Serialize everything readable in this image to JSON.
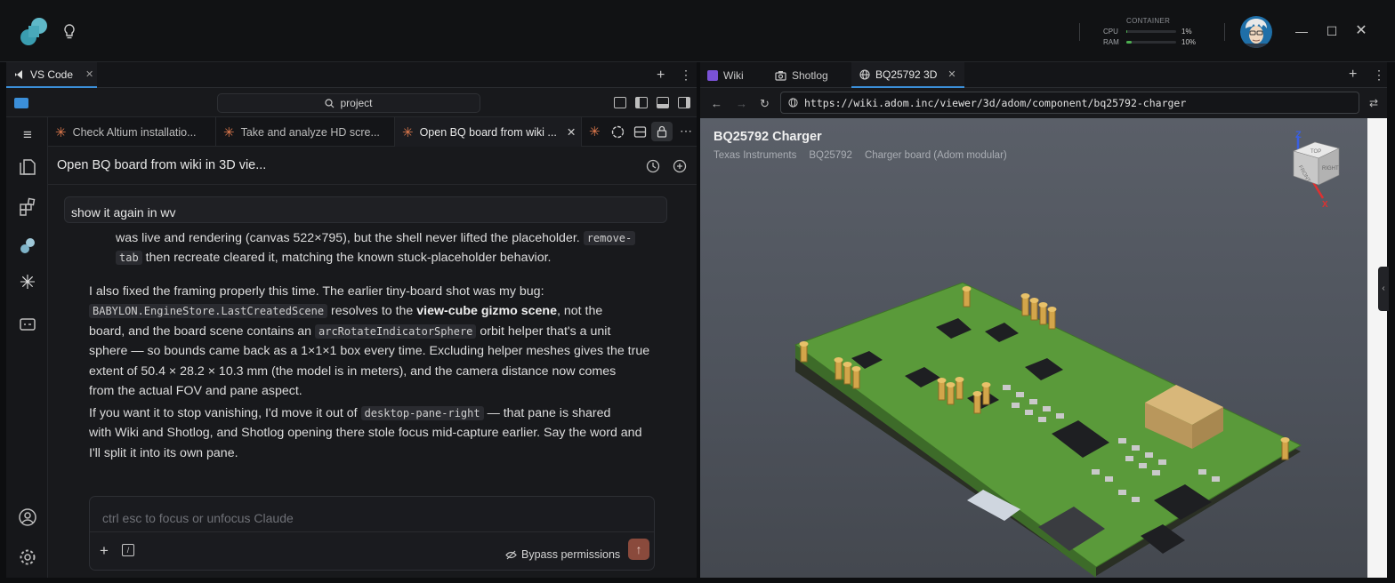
{
  "window": {
    "container_label": "CONTAINER",
    "cpu_label": "CPU",
    "cpu_value": "1%",
    "cpu_fraction": 0.01,
    "ram_label": "RAM",
    "ram_value": "10%",
    "ram_fraction": 0.1
  },
  "left": {
    "tab_label": "VS Code",
    "search_placeholder": "project",
    "editor_tabs": [
      {
        "label": "Check Altium installatio..."
      },
      {
        "label": "Take and analyze HD scre..."
      },
      {
        "label": "Open BQ board from wiki ..."
      }
    ],
    "chat_title": "Open BQ board from wiki in 3D vie...",
    "user_message": "show it again in wv",
    "p1_a": "was live and rendering (canvas 522×795), but the shell never lifted the placeholder.",
    "p1_code1a": "remove-",
    "p1_code1b": "tab",
    "p1_b": "then recreate cleared it, matching the known stuck-placeholder behavior.",
    "p2_a": "I also fixed the framing properly this time. The earlier tiny-board shot was my bug:",
    "p2_code1": "BABYLON.EngineStore.LastCreatedScene",
    "p2_b": "resolves to the",
    "p2_bold": "view-cube gizmo scene",
    "p2_c": ", not the",
    "p2_d": "board, and the board scene contains an",
    "p2_code2": "arcRotateIndicatorSphere",
    "p2_e": "orbit helper that's a unit",
    "p2_f": "sphere — so bounds came back as a 1×1×1 box every time. Excluding helper meshes gives the true",
    "p2_g": "extent of 50.4 × 28.2 × 10.3 mm (the model is in meters), and the camera distance now comes",
    "p2_h": "from the actual FOV and pane aspect.",
    "p3_a": "If you want it to stop vanishing, I'd move it out of",
    "p3_code": "desktop-pane-right",
    "p3_b": "— that pane is shared",
    "p3_c": "with Wiki and Shotlog, and Shotlog opening there stole focus mid-capture earlier. Say the word and",
    "p3_d": "I'll split it into its own pane.",
    "input_placeholder": "ctrl esc to focus or unfocus Claude",
    "bypass_label": "Bypass permissions"
  },
  "right": {
    "tabs": [
      {
        "label": "Wiki"
      },
      {
        "label": "Shotlog"
      },
      {
        "label": "BQ25792 3D"
      }
    ],
    "url": "https://wiki.adom.inc/viewer/3d/adom/component/bq25792-charger",
    "viewer_title": "BQ25792 Charger",
    "crumbs": [
      "Texas Instruments",
      "BQ25792",
      "Charger board (Adom modular)"
    ],
    "cube_top": "TOP",
    "cube_front": "FRONT",
    "cube_right": "RIGHT",
    "axis_z": "Z",
    "axis_x": "X"
  },
  "colors": {
    "accent": "#3b8fd9",
    "claude_star": "#e07a4d",
    "pcb_green": "#5a9a3a"
  }
}
